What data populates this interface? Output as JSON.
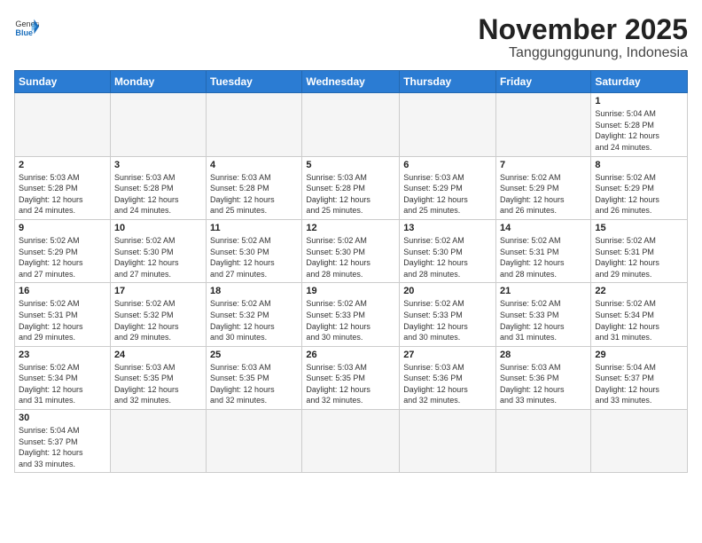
{
  "header": {
    "logo_general": "General",
    "logo_blue": "Blue",
    "month_year": "November 2025",
    "location": "Tanggunggunung, Indonesia"
  },
  "weekdays": [
    "Sunday",
    "Monday",
    "Tuesday",
    "Wednesday",
    "Thursday",
    "Friday",
    "Saturday"
  ],
  "weeks": [
    [
      {
        "day": "",
        "info": ""
      },
      {
        "day": "",
        "info": ""
      },
      {
        "day": "",
        "info": ""
      },
      {
        "day": "",
        "info": ""
      },
      {
        "day": "",
        "info": ""
      },
      {
        "day": "",
        "info": ""
      },
      {
        "day": "1",
        "info": "Sunrise: 5:04 AM\nSunset: 5:28 PM\nDaylight: 12 hours\nand 24 minutes."
      }
    ],
    [
      {
        "day": "2",
        "info": "Sunrise: 5:03 AM\nSunset: 5:28 PM\nDaylight: 12 hours\nand 24 minutes."
      },
      {
        "day": "3",
        "info": "Sunrise: 5:03 AM\nSunset: 5:28 PM\nDaylight: 12 hours\nand 24 minutes."
      },
      {
        "day": "4",
        "info": "Sunrise: 5:03 AM\nSunset: 5:28 PM\nDaylight: 12 hours\nand 25 minutes."
      },
      {
        "day": "5",
        "info": "Sunrise: 5:03 AM\nSunset: 5:28 PM\nDaylight: 12 hours\nand 25 minutes."
      },
      {
        "day": "6",
        "info": "Sunrise: 5:03 AM\nSunset: 5:29 PM\nDaylight: 12 hours\nand 25 minutes."
      },
      {
        "day": "7",
        "info": "Sunrise: 5:02 AM\nSunset: 5:29 PM\nDaylight: 12 hours\nand 26 minutes."
      },
      {
        "day": "8",
        "info": "Sunrise: 5:02 AM\nSunset: 5:29 PM\nDaylight: 12 hours\nand 26 minutes."
      }
    ],
    [
      {
        "day": "9",
        "info": "Sunrise: 5:02 AM\nSunset: 5:29 PM\nDaylight: 12 hours\nand 27 minutes."
      },
      {
        "day": "10",
        "info": "Sunrise: 5:02 AM\nSunset: 5:30 PM\nDaylight: 12 hours\nand 27 minutes."
      },
      {
        "day": "11",
        "info": "Sunrise: 5:02 AM\nSunset: 5:30 PM\nDaylight: 12 hours\nand 27 minutes."
      },
      {
        "day": "12",
        "info": "Sunrise: 5:02 AM\nSunset: 5:30 PM\nDaylight: 12 hours\nand 28 minutes."
      },
      {
        "day": "13",
        "info": "Sunrise: 5:02 AM\nSunset: 5:30 PM\nDaylight: 12 hours\nand 28 minutes."
      },
      {
        "day": "14",
        "info": "Sunrise: 5:02 AM\nSunset: 5:31 PM\nDaylight: 12 hours\nand 28 minutes."
      },
      {
        "day": "15",
        "info": "Sunrise: 5:02 AM\nSunset: 5:31 PM\nDaylight: 12 hours\nand 29 minutes."
      }
    ],
    [
      {
        "day": "16",
        "info": "Sunrise: 5:02 AM\nSunset: 5:31 PM\nDaylight: 12 hours\nand 29 minutes."
      },
      {
        "day": "17",
        "info": "Sunrise: 5:02 AM\nSunset: 5:32 PM\nDaylight: 12 hours\nand 29 minutes."
      },
      {
        "day": "18",
        "info": "Sunrise: 5:02 AM\nSunset: 5:32 PM\nDaylight: 12 hours\nand 30 minutes."
      },
      {
        "day": "19",
        "info": "Sunrise: 5:02 AM\nSunset: 5:33 PM\nDaylight: 12 hours\nand 30 minutes."
      },
      {
        "day": "20",
        "info": "Sunrise: 5:02 AM\nSunset: 5:33 PM\nDaylight: 12 hours\nand 30 minutes."
      },
      {
        "day": "21",
        "info": "Sunrise: 5:02 AM\nSunset: 5:33 PM\nDaylight: 12 hours\nand 31 minutes."
      },
      {
        "day": "22",
        "info": "Sunrise: 5:02 AM\nSunset: 5:34 PM\nDaylight: 12 hours\nand 31 minutes."
      }
    ],
    [
      {
        "day": "23",
        "info": "Sunrise: 5:02 AM\nSunset: 5:34 PM\nDaylight: 12 hours\nand 31 minutes."
      },
      {
        "day": "24",
        "info": "Sunrise: 5:03 AM\nSunset: 5:35 PM\nDaylight: 12 hours\nand 32 minutes."
      },
      {
        "day": "25",
        "info": "Sunrise: 5:03 AM\nSunset: 5:35 PM\nDaylight: 12 hours\nand 32 minutes."
      },
      {
        "day": "26",
        "info": "Sunrise: 5:03 AM\nSunset: 5:35 PM\nDaylight: 12 hours\nand 32 minutes."
      },
      {
        "day": "27",
        "info": "Sunrise: 5:03 AM\nSunset: 5:36 PM\nDaylight: 12 hours\nand 32 minutes."
      },
      {
        "day": "28",
        "info": "Sunrise: 5:03 AM\nSunset: 5:36 PM\nDaylight: 12 hours\nand 33 minutes."
      },
      {
        "day": "29",
        "info": "Sunrise: 5:04 AM\nSunset: 5:37 PM\nDaylight: 12 hours\nand 33 minutes."
      }
    ],
    [
      {
        "day": "30",
        "info": "Sunrise: 5:04 AM\nSunset: 5:37 PM\nDaylight: 12 hours\nand 33 minutes."
      },
      {
        "day": "",
        "info": ""
      },
      {
        "day": "",
        "info": ""
      },
      {
        "day": "",
        "info": ""
      },
      {
        "day": "",
        "info": ""
      },
      {
        "day": "",
        "info": ""
      },
      {
        "day": "",
        "info": ""
      }
    ]
  ]
}
